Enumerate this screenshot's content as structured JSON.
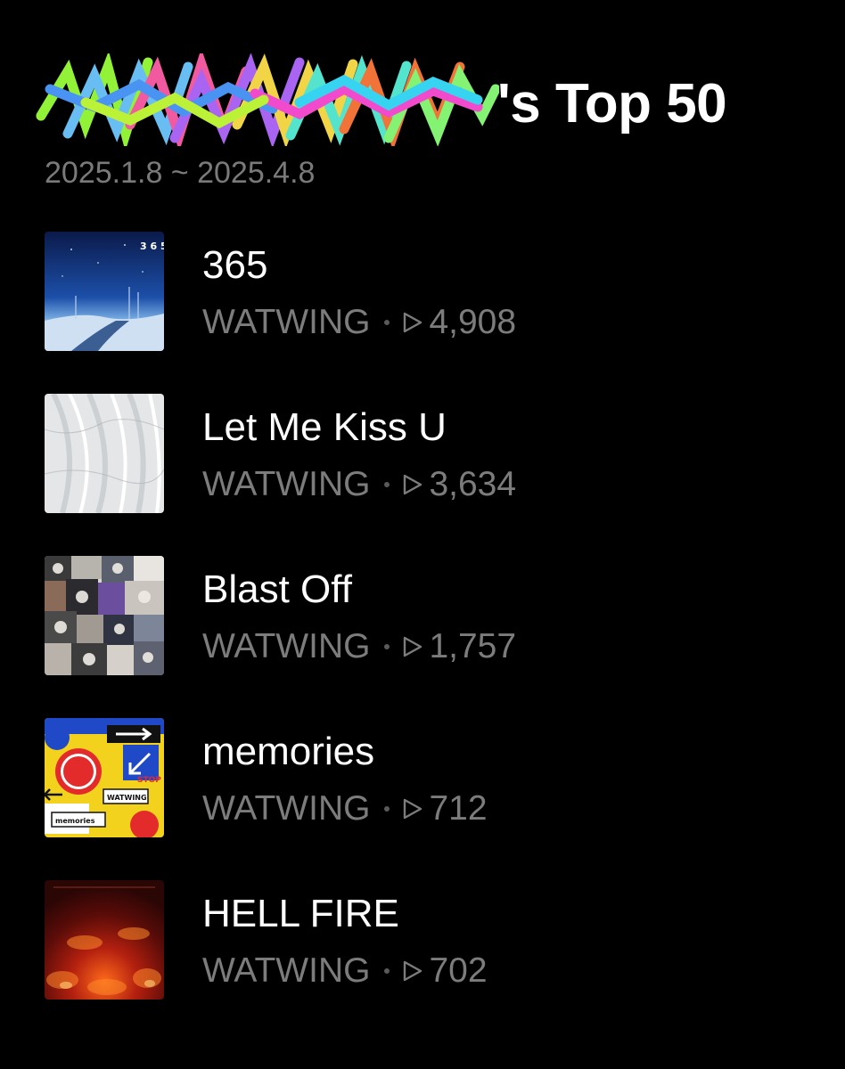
{
  "header": {
    "title": "'s Top 50",
    "date_range": "2025.1.8 ~ 2025.4.8"
  },
  "tracks": [
    {
      "title": "365",
      "artist": "WATWING",
      "plays": "4,908",
      "cover": "night-snow-road-cover"
    },
    {
      "title": "Let Me Kiss U",
      "artist": "WATWING",
      "plays": "3,634",
      "cover": "white-snow-mountain-cover"
    },
    {
      "title": "Blast Off",
      "artist": "WATWING",
      "plays": "1,757",
      "cover": "collage-cover"
    },
    {
      "title": "memories",
      "artist": "WATWING",
      "plays": "712",
      "cover": "road-signs-cover"
    },
    {
      "title": "HELL FIRE",
      "artist": "WATWING",
      "plays": "702",
      "cover": "red-fire-cover"
    }
  ],
  "covers": {
    "track_1_cover_text": "3 6 5",
    "track_4_cover_labels": [
      "WATWING",
      "memories",
      "STOP"
    ]
  },
  "colors": {
    "background": "#000000",
    "primary_text": "#ffffff",
    "secondary_text": "#7c7c7c"
  }
}
